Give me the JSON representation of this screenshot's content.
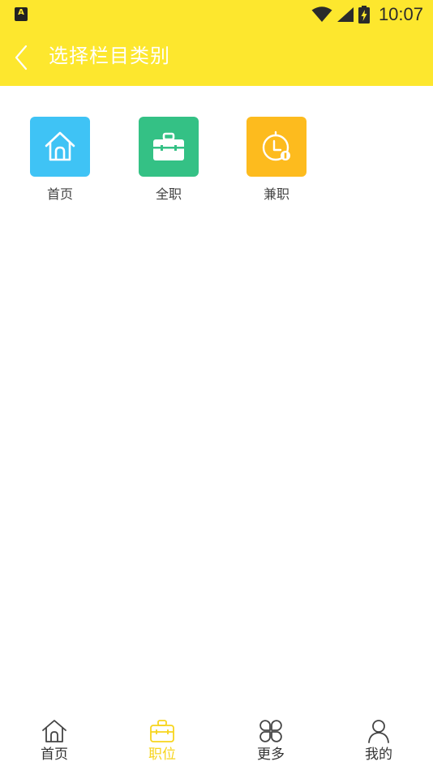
{
  "status_bar": {
    "time": "10:07",
    "app_icon_letter": "A"
  },
  "header": {
    "title": "选择栏目类别",
    "back_icon": "chevron-left-icon"
  },
  "categories": [
    {
      "label": "首页",
      "icon": "home-icon",
      "color": "#3fc3f5"
    },
    {
      "label": "全职",
      "icon": "briefcase-icon",
      "color": "#34c185"
    },
    {
      "label": "兼职",
      "icon": "clock-icon",
      "color": "#fdbb1e"
    }
  ],
  "bottom_nav": {
    "active_color": "#f7d51d",
    "items": [
      {
        "label": "首页",
        "icon": "home-icon",
        "active": false
      },
      {
        "label": "职位",
        "icon": "briefcase-icon",
        "active": true
      },
      {
        "label": "更多",
        "icon": "grid-icon",
        "active": false
      },
      {
        "label": "我的",
        "icon": "user-icon",
        "active": false
      }
    ]
  }
}
